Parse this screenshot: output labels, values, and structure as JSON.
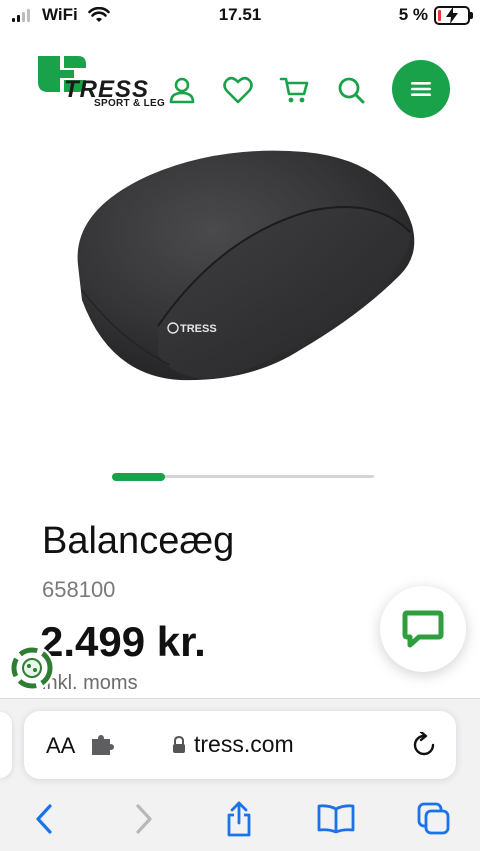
{
  "status_bar": {
    "carrier": "WiFi",
    "time": "17.51",
    "battery_percent": "5 %",
    "signal_bars_active": 2,
    "signal_bars_total": 4
  },
  "header": {
    "logo_name": "TRESS",
    "logo_tagline": "SPORT & LEG",
    "icons": [
      "user-icon",
      "heart-icon",
      "cart-icon",
      "search-icon",
      "menu-icon"
    ],
    "accent_color": "#1aa24b"
  },
  "carousel": {
    "current_slide_fraction": 0.2
  },
  "product": {
    "title": "Balanceæg",
    "sku": "658100",
    "price": "2.499 kr.",
    "vat_note": "inkl. moms",
    "image_brand": "TRESS"
  },
  "floating": {
    "chat_icon": "chat-bubble-icon",
    "badge_icon": "recycle-badge-icon"
  },
  "browser": {
    "text_size_label": "AA",
    "url": "tress.com",
    "toolbar": [
      "back-icon",
      "forward-icon",
      "share-icon",
      "bookmarks-icon",
      "tabs-icon"
    ]
  }
}
